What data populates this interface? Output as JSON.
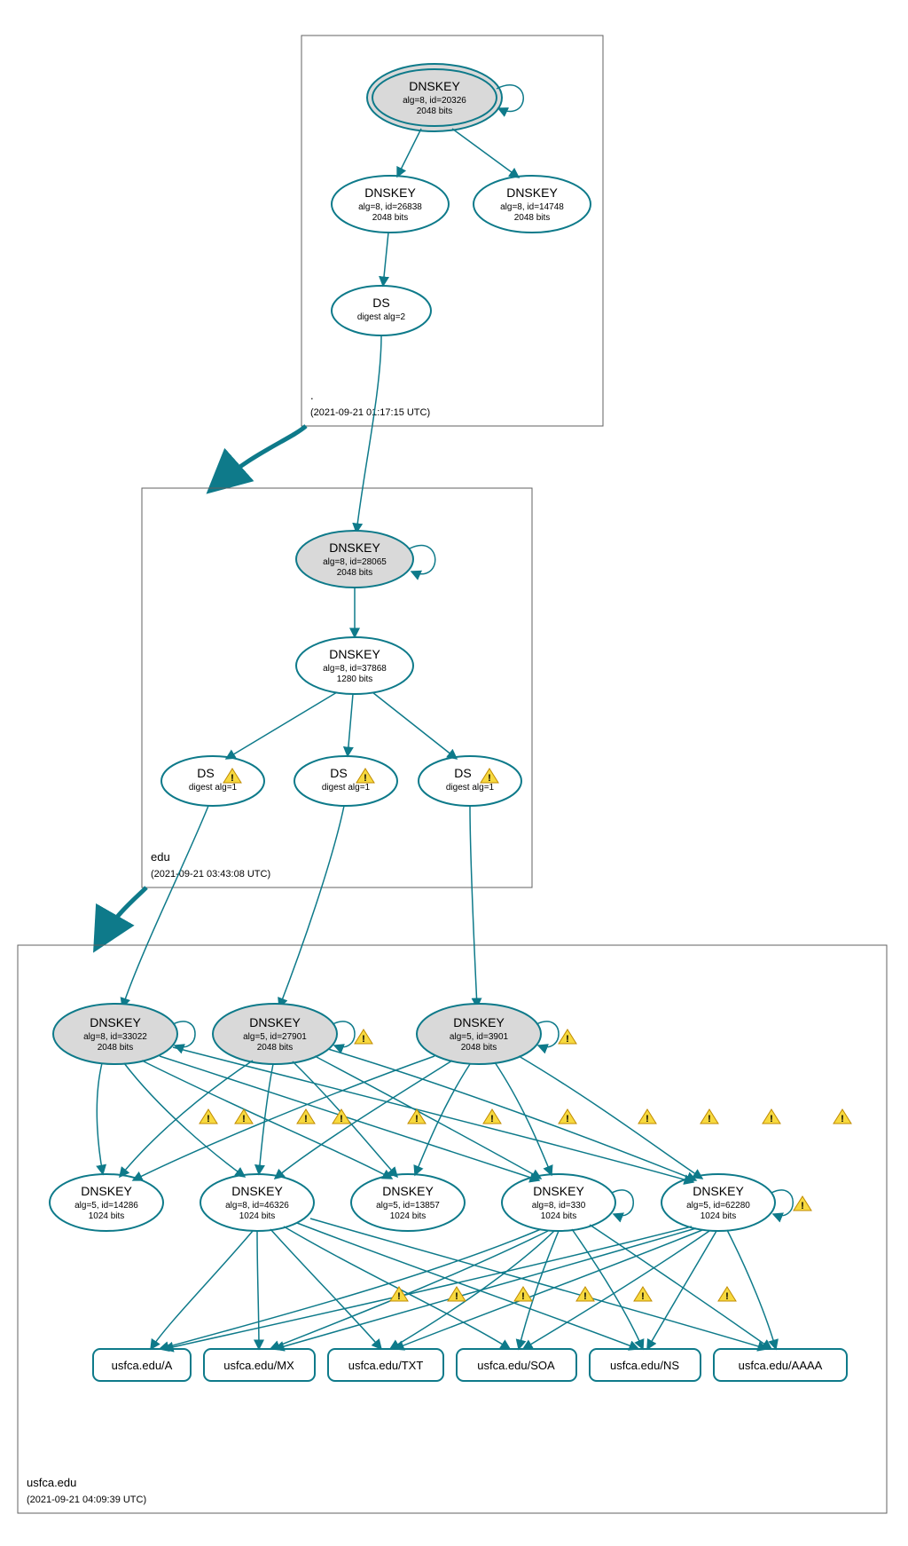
{
  "zones": {
    "root": {
      "name": ".",
      "timestamp": "(2021-09-21 01:17:15 UTC)"
    },
    "edu": {
      "name": "edu",
      "timestamp": "(2021-09-21 03:43:08 UTC)"
    },
    "usfca": {
      "name": "usfca.edu",
      "timestamp": "(2021-09-21 04:09:39 UTC)"
    }
  },
  "nodes": {
    "root_ksk": {
      "title": "DNSKEY",
      "line1": "alg=8, id=20326",
      "line2": "2048 bits"
    },
    "root_zsk1": {
      "title": "DNSKEY",
      "line1": "alg=8, id=26838",
      "line2": "2048 bits"
    },
    "root_zsk2": {
      "title": "DNSKEY",
      "line1": "alg=8, id=14748",
      "line2": "2048 bits"
    },
    "root_ds": {
      "title": "DS",
      "line1": "digest alg=2"
    },
    "edu_ksk": {
      "title": "DNSKEY",
      "line1": "alg=8, id=28065",
      "line2": "2048 bits"
    },
    "edu_zsk": {
      "title": "DNSKEY",
      "line1": "alg=8, id=37868",
      "line2": "1280 bits"
    },
    "edu_ds1": {
      "title": "DS",
      "line1": "digest alg=1"
    },
    "edu_ds2": {
      "title": "DS",
      "line1": "digest alg=1"
    },
    "edu_ds3": {
      "title": "DS",
      "line1": "digest alg=1"
    },
    "u_ksk1": {
      "title": "DNSKEY",
      "line1": "alg=8, id=33022",
      "line2": "2048 bits"
    },
    "u_ksk2": {
      "title": "DNSKEY",
      "line1": "alg=5, id=27901",
      "line2": "2048 bits"
    },
    "u_ksk3": {
      "title": "DNSKEY",
      "line1": "alg=5, id=3901",
      "line2": "2048 bits"
    },
    "u_zsk1": {
      "title": "DNSKEY",
      "line1": "alg=5, id=14286",
      "line2": "1024 bits"
    },
    "u_zsk2": {
      "title": "DNSKEY",
      "line1": "alg=8, id=46326",
      "line2": "1024 bits"
    },
    "u_zsk3": {
      "title": "DNSKEY",
      "line1": "alg=5, id=13857",
      "line2": "1024 bits"
    },
    "u_zsk4": {
      "title": "DNSKEY",
      "line1": "alg=8, id=330",
      "line2": "1024 bits"
    },
    "u_zsk5": {
      "title": "DNSKEY",
      "line1": "alg=5, id=62280",
      "line2": "1024 bits"
    }
  },
  "rrsets": {
    "a": "usfca.edu/A",
    "mx": "usfca.edu/MX",
    "txt": "usfca.edu/TXT",
    "soa": "usfca.edu/SOA",
    "ns": "usfca.edu/NS",
    "aaaa": "usfca.edu/AAAA"
  }
}
